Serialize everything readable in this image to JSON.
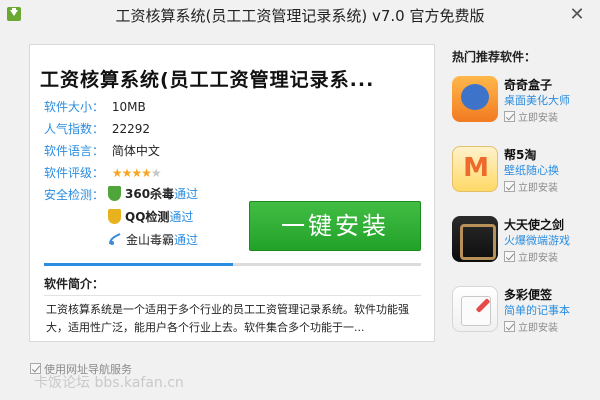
{
  "window": {
    "title": "工资核算系统(员工工资管理记录系统) v7.0 官方免费版",
    "close_glyph": "✕"
  },
  "software": {
    "title": "工资核算系统(员工工资管理记录系...",
    "info": [
      {
        "label": "软件大小：",
        "value": "10MB"
      },
      {
        "label": "人气指数：",
        "value": "22292"
      },
      {
        "label": "软件语言：",
        "value": "简体中文"
      },
      {
        "label": "软件评级：",
        "value": ""
      }
    ],
    "rating": 4,
    "rating_max": 5,
    "rating_stars_full": "★★★★",
    "rating_stars_empty": "★",
    "security_label": "安全检测：",
    "security_checks": [
      {
        "name": "360杀毒",
        "status": "通过",
        "icon": "shield-360-icon"
      },
      {
        "name": "QQ检测",
        "status": "通过",
        "icon": "shield-qq-icon"
      },
      {
        "name": "金山毒霸",
        "status": "通过",
        "icon": "shield-jinshan-icon"
      }
    ],
    "install_button": "一键安装",
    "progress": 0.5,
    "intro_heading": "软件简介：",
    "intro_text": "工资核算系统是一个适用于多个行业的员工工资管理记录系统。软件功能强大，适用性广泛，能用户各个行业上去。软件集合多个功能于一..."
  },
  "recommend": {
    "heading": "热门推荐软件：",
    "items": [
      {
        "name": "奇奇盒子",
        "desc": "桌面美化大师",
        "install": "立即安装",
        "checked": true
      },
      {
        "name": "帮5淘",
        "desc": "壁纸随心换",
        "install": "立即安装",
        "checked": true
      },
      {
        "name": "大天使之剑",
        "desc": "火爆微端游戏",
        "install": "立即安装",
        "checked": true
      },
      {
        "name": "多彩便签",
        "desc": "简单的记事本",
        "install": "立即安装",
        "checked": true
      }
    ]
  },
  "footer": {
    "nav_option": "使用网址导航服务",
    "nav_checked": true,
    "watermark": "卡饭论坛 bbs.kafan.cn"
  },
  "colors": {
    "accent_blue": "#2b8de0",
    "install_green": "#22a229",
    "star": "#f5a623"
  }
}
